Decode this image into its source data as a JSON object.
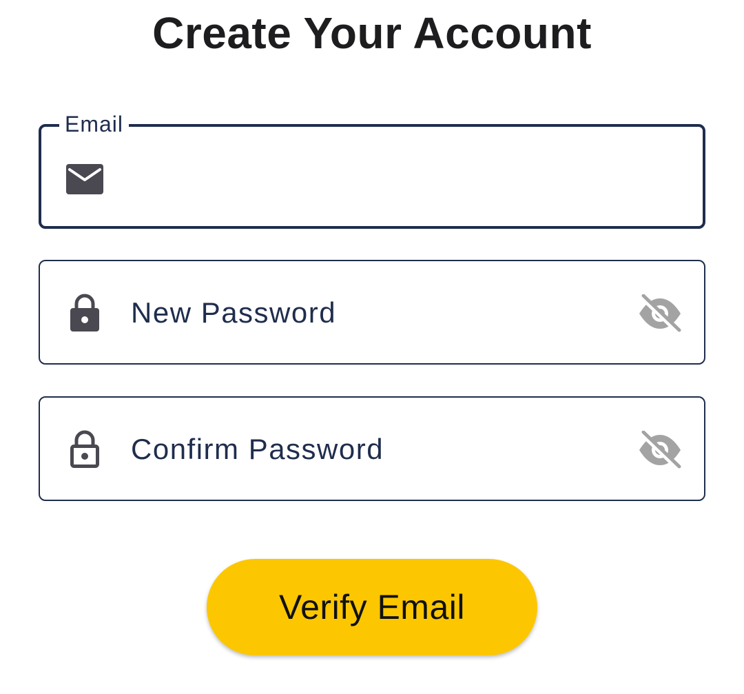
{
  "page": {
    "title": "Create Your Account"
  },
  "form": {
    "email": {
      "label": "Email",
      "value": "",
      "icon": "mail-icon"
    },
    "new_password": {
      "placeholder": "New Password",
      "value": "",
      "icon": "lock-filled-icon",
      "toggle_icon": "eye-off-icon"
    },
    "confirm_password": {
      "placeholder": "Confirm Password",
      "value": "",
      "icon": "lock-outline-icon",
      "toggle_icon": "eye-off-icon"
    },
    "submit_label": "Verify Email"
  },
  "colors": {
    "border": "#1f2d4d",
    "icon": "#4a4851",
    "eye_icon": "#a3a3a3",
    "button": "#fcc700",
    "title": "#1d1d1f"
  }
}
